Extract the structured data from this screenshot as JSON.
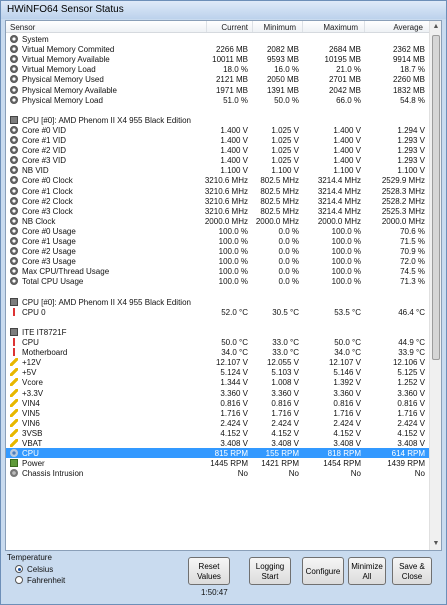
{
  "window": {
    "title": "HWiNFO64 Sensor Status"
  },
  "columns": {
    "sensor": "Sensor",
    "current": "Current",
    "minimum": "Minimum",
    "maximum": "Maximum",
    "average": "Average"
  },
  "rows": [
    {
      "icon": "gear",
      "label": "System",
      "cur": "",
      "min": "",
      "max": "",
      "avg": ""
    },
    {
      "icon": "gear",
      "label": "Virtual Memory Commited",
      "cur": "2266 MB",
      "min": "2082 MB",
      "max": "2684 MB",
      "avg": "2362 MB"
    },
    {
      "icon": "gear",
      "label": "Virtual Memory Available",
      "cur": "10011 MB",
      "min": "9593 MB",
      "max": "10195 MB",
      "avg": "9914 MB"
    },
    {
      "icon": "gear",
      "label": "Virtual Memory Load",
      "cur": "18.0 %",
      "min": "16.0 %",
      "max": "21.0 %",
      "avg": "18.7 %"
    },
    {
      "icon": "gear",
      "label": "Physical Memory Used",
      "cur": "2121 MB",
      "min": "2050 MB",
      "max": "2701 MB",
      "avg": "2260 MB"
    },
    {
      "icon": "gear",
      "label": "Physical Memory Available",
      "cur": "1971 MB",
      "min": "1391 MB",
      "max": "2042 MB",
      "avg": "1832 MB"
    },
    {
      "icon": "gear",
      "label": "Physical Memory Load",
      "cur": "51.0 %",
      "min": "50.0 %",
      "max": "66.0 %",
      "avg": "54.8 %"
    },
    {
      "icon": "",
      "label": "",
      "cur": "",
      "min": "",
      "max": "",
      "avg": ""
    },
    {
      "icon": "chip",
      "label": "CPU [#0]: AMD Phenom II X4 955 Black Edition",
      "cur": "",
      "min": "",
      "max": "",
      "avg": ""
    },
    {
      "icon": "gear",
      "label": "Core #0 VID",
      "cur": "1.400 V",
      "min": "1.025 V",
      "max": "1.400 V",
      "avg": "1.294 V"
    },
    {
      "icon": "gear",
      "label": "Core #1 VID",
      "cur": "1.400 V",
      "min": "1.025 V",
      "max": "1.400 V",
      "avg": "1.293 V"
    },
    {
      "icon": "gear",
      "label": "Core #2 VID",
      "cur": "1.400 V",
      "min": "1.025 V",
      "max": "1.400 V",
      "avg": "1.293 V"
    },
    {
      "icon": "gear",
      "label": "Core #3 VID",
      "cur": "1.400 V",
      "min": "1.025 V",
      "max": "1.400 V",
      "avg": "1.293 V"
    },
    {
      "icon": "gear",
      "label": "NB VID",
      "cur": "1.100 V",
      "min": "1.100 V",
      "max": "1.100 V",
      "avg": "1.100 V"
    },
    {
      "icon": "gear",
      "label": "Core #0 Clock",
      "cur": "3210.6 MHz",
      "min": "802.5 MHz",
      "max": "3214.4 MHz",
      "avg": "2529.9 MHz"
    },
    {
      "icon": "gear",
      "label": "Core #1 Clock",
      "cur": "3210.6 MHz",
      "min": "802.5 MHz",
      "max": "3214.4 MHz",
      "avg": "2528.3 MHz"
    },
    {
      "icon": "gear",
      "label": "Core #2 Clock",
      "cur": "3210.6 MHz",
      "min": "802.5 MHz",
      "max": "3214.4 MHz",
      "avg": "2528.2 MHz"
    },
    {
      "icon": "gear",
      "label": "Core #3 Clock",
      "cur": "3210.6 MHz",
      "min": "802.5 MHz",
      "max": "3214.4 MHz",
      "avg": "2525.3 MHz"
    },
    {
      "icon": "gear",
      "label": "NB Clock",
      "cur": "2000.0 MHz",
      "min": "2000.0 MHz",
      "max": "2000.0 MHz",
      "avg": "2000.0 MHz"
    },
    {
      "icon": "gear",
      "label": "Core #0 Usage",
      "cur": "100.0 %",
      "min": "0.0 %",
      "max": "100.0 %",
      "avg": "70.6 %"
    },
    {
      "icon": "gear",
      "label": "Core #1 Usage",
      "cur": "100.0 %",
      "min": "0.0 %",
      "max": "100.0 %",
      "avg": "71.5 %"
    },
    {
      "icon": "gear",
      "label": "Core #2 Usage",
      "cur": "100.0 %",
      "min": "0.0 %",
      "max": "100.0 %",
      "avg": "70.9 %"
    },
    {
      "icon": "gear",
      "label": "Core #3 Usage",
      "cur": "100.0 %",
      "min": "0.0 %",
      "max": "100.0 %",
      "avg": "72.0 %"
    },
    {
      "icon": "gear",
      "label": "Max CPU/Thread Usage",
      "cur": "100.0 %",
      "min": "0.0 %",
      "max": "100.0 %",
      "avg": "74.5 %"
    },
    {
      "icon": "gear",
      "label": "Total CPU Usage",
      "cur": "100.0 %",
      "min": "0.0 %",
      "max": "100.0 %",
      "avg": "71.3 %"
    },
    {
      "icon": "",
      "label": "",
      "cur": "",
      "min": "",
      "max": "",
      "avg": ""
    },
    {
      "icon": "chip",
      "label": "CPU [#0]: AMD Phenom II X4 955 Black Edition",
      "cur": "",
      "min": "",
      "max": "",
      "avg": ""
    },
    {
      "icon": "temp",
      "label": "CPU 0",
      "cur": "52.0 °C",
      "min": "30.5 °C",
      "max": "53.5 °C",
      "avg": "46.4 °C"
    },
    {
      "icon": "",
      "label": "",
      "cur": "",
      "min": "",
      "max": "",
      "avg": ""
    },
    {
      "icon": "chip",
      "label": "ITE IT8721F",
      "cur": "",
      "min": "",
      "max": "",
      "avg": ""
    },
    {
      "icon": "temp",
      "label": "CPU",
      "cur": "50.0 °C",
      "min": "33.0 °C",
      "max": "50.0 °C",
      "avg": "44.9 °C"
    },
    {
      "icon": "temp",
      "label": "Motherboard",
      "cur": "34.0 °C",
      "min": "33.0 °C",
      "max": "34.0 °C",
      "avg": "33.9 °C"
    },
    {
      "icon": "volt",
      "label": "+12V",
      "cur": "12.107 V",
      "min": "12.055 V",
      "max": "12.107 V",
      "avg": "12.106 V"
    },
    {
      "icon": "volt",
      "label": "+5V",
      "cur": "5.124 V",
      "min": "5.103 V",
      "max": "5.146 V",
      "avg": "5.125 V"
    },
    {
      "icon": "volt",
      "label": "Vcore",
      "cur": "1.344 V",
      "min": "1.008 V",
      "max": "1.392 V",
      "avg": "1.252 V"
    },
    {
      "icon": "volt",
      "label": "+3.3V",
      "cur": "3.360 V",
      "min": "3.360 V",
      "max": "3.360 V",
      "avg": "3.360 V"
    },
    {
      "icon": "volt",
      "label": "VIN4",
      "cur": "0.816 V",
      "min": "0.816 V",
      "max": "0.816 V",
      "avg": "0.816 V"
    },
    {
      "icon": "volt",
      "label": "VIN5",
      "cur": "1.716 V",
      "min": "1.716 V",
      "max": "1.716 V",
      "avg": "1.716 V"
    },
    {
      "icon": "volt",
      "label": "VIN6",
      "cur": "2.424 V",
      "min": "2.424 V",
      "max": "2.424 V",
      "avg": "2.424 V"
    },
    {
      "icon": "volt",
      "label": "3VSB",
      "cur": "4.152 V",
      "min": "4.152 V",
      "max": "4.152 V",
      "avg": "4.152 V"
    },
    {
      "icon": "volt",
      "label": "VBAT",
      "cur": "3.408 V",
      "min": "3.408 V",
      "max": "3.408 V",
      "avg": "3.408 V"
    },
    {
      "icon": "fan",
      "label": "CPU",
      "cur": "815 RPM",
      "min": "155 RPM",
      "max": "818 RPM",
      "avg": "614 RPM",
      "selected": true
    },
    {
      "icon": "pow",
      "label": "Power",
      "cur": "1445 RPM",
      "min": "1421 RPM",
      "max": "1454 RPM",
      "avg": "1439 RPM"
    },
    {
      "icon": "chs",
      "label": "Chassis Intrusion",
      "cur": "No",
      "min": "No",
      "max": "No",
      "avg": "No"
    }
  ],
  "temperature": {
    "label": "Temperature",
    "celsius": "Celsius",
    "fahrenheit": "Fahrenheit",
    "selected": "Celsius"
  },
  "buttons": {
    "reset": "Reset Values",
    "logging": "Logging Start",
    "configure": "Configure",
    "minimize": "Minimize All",
    "save_close": "Save & Close"
  },
  "timer": "1:50:47"
}
